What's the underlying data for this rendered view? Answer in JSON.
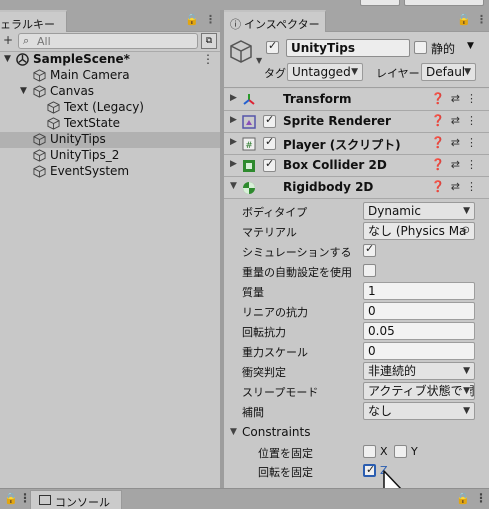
{
  "hierarchy": {
    "tab_label": "ェラルキー",
    "search_placeholder": "All",
    "scene_name": "SampleScene*",
    "items": [
      {
        "label": "Main Camera"
      },
      {
        "label": "Canvas"
      },
      {
        "label": "Text (Legacy)"
      },
      {
        "label": "TextState"
      },
      {
        "label": "UnityTips"
      },
      {
        "label": "UnityTips_2"
      },
      {
        "label": "EventSystem"
      }
    ]
  },
  "inspector": {
    "tab_label": "インスペクター",
    "object_name": "UnityTips",
    "static_label": "静的",
    "tag_label": "タグ",
    "tag_value": "Untagged",
    "layer_label": "レイヤー",
    "layer_value": "Defaul"
  },
  "components": [
    {
      "title": "Transform"
    },
    {
      "title": "Sprite Renderer"
    },
    {
      "title": "Player (スクリプト)"
    },
    {
      "title": "Box Collider 2D"
    },
    {
      "title": "Rigidbody 2D"
    }
  ],
  "rigidbody": {
    "body_type_label": "ボディタイプ",
    "body_type_value": "Dynamic",
    "material_label": "マテリアル",
    "material_value": "なし (Physics Ma",
    "simulated_label": "シミュレーションする",
    "auto_mass_label": "重量の自動設定を使用",
    "mass_label": "質量",
    "mass_value": "1",
    "linear_drag_label": "リニアの抗力",
    "linear_drag_value": "0",
    "angular_drag_label": "回転抗力",
    "angular_drag_value": "0.05",
    "gravity_scale_label": "重力スケール",
    "gravity_scale_value": "0",
    "collision_label": "衝突判定",
    "collision_value": "非連続的",
    "sleep_label": "スリープモード",
    "sleep_value": "アクティブ状態で開始",
    "interp_label": "補間",
    "interp_value": "なし",
    "constraints_label": "Constraints",
    "freeze_pos_label": "位置を固定",
    "freeze_rot_label": "回転を固定",
    "x_label": "X",
    "y_label": "Y",
    "z_label": "Z"
  },
  "bottom": {
    "console_label": "コンソール"
  },
  "colors": {
    "selected_row": "#b1b1b1",
    "panel_bg": "#c8c8c8",
    "z_text": "#2a5db0"
  }
}
